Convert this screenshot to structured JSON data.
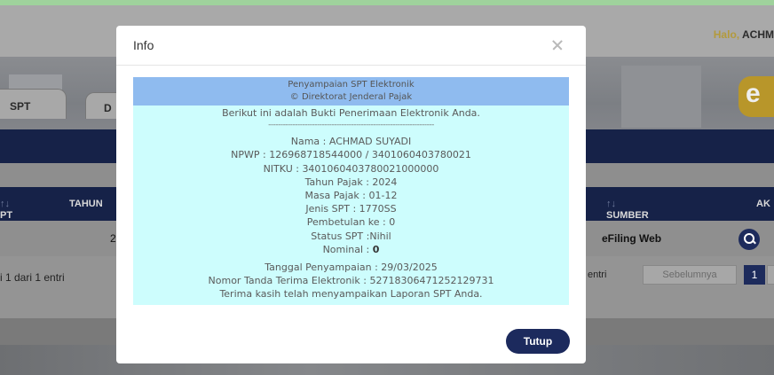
{
  "header": {
    "greeting": "Halo,",
    "user_name": "ACHM"
  },
  "tabs": [
    "SPT",
    "D"
  ],
  "logo_letter": "e",
  "table": {
    "columns": [
      "PT",
      "TAHUN",
      "SUMBER",
      "AK"
    ],
    "row": {
      "year_fragment": "2",
      "source": "eFiling Web"
    },
    "info": "i 1 dari 1 entri",
    "entries_fragment": "entri"
  },
  "pagination": {
    "prev": "Sebelumnya",
    "current": "1"
  },
  "modal": {
    "title": "Info",
    "close_icon": "close-icon",
    "receipt": {
      "header_line1": "Penyampaian SPT Elektronik",
      "header_line2": "© Direktorat Jenderal Pajak",
      "intro": "Berikut ini adalah Bukti Penerimaan Elektronik Anda.",
      "divider": "--------------------------------------------------------------------",
      "nama": "Nama : ACHMAD SUYADI",
      "npwp": "NPWP : 126968718544000 / 3401060403780021",
      "nitku": "NITKU : 3401060403780021000000",
      "tahun_pajak": "Tahun Pajak : 2024",
      "masa_pajak": "Masa Pajak : 01-12",
      "jenis_spt": "Jenis SPT : 1770SS",
      "pembetulan": "Pembetulan ke : 0",
      "status": "Status SPT :Nihil",
      "nominal_label": "Nominal : ",
      "nominal_value": "0",
      "tanggal": "Tanggal Penyampaian : 29/03/2025",
      "nomor_tanda": "Nomor Tanda Terima Elektronik : 52718306471252129731",
      "terima_kasih": "Terima kasih telah menyampaikan Laporan SPT Anda."
    },
    "close_button": "Tutup"
  },
  "colors": {
    "navy": "#1c2a5d",
    "receipt_bg": "#cdfdfd",
    "receipt_header": "#8fbbef",
    "greeting_gold": "#b39a3c"
  }
}
